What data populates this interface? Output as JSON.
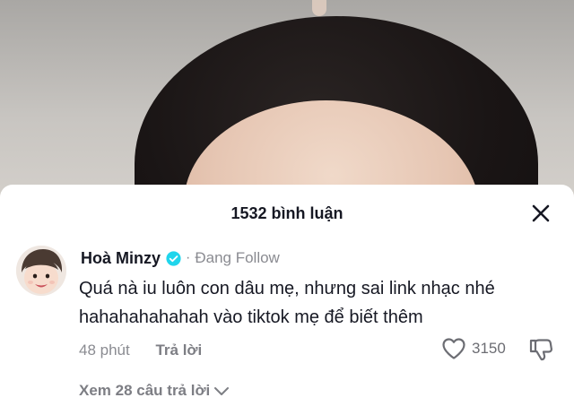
{
  "video": {
    "description_icon": "video-background"
  },
  "sheet": {
    "comment_count_label": "1532 bình luận",
    "close_icon": "close-icon"
  },
  "comment": {
    "username": "Hoà Minzy",
    "verified_icon": "verified-badge-icon",
    "separator": "·",
    "follow_status": "Đang Follow",
    "text": "Quá nà iu luôn con dâu mẹ, nhưng sai link nhạc nhé hahahahahahah vào tiktok mẹ để biết thêm",
    "time": "48 phút",
    "reply_label": "Trả lời",
    "like_count": "3150",
    "view_replies_label": "Xem 28 câu trả lời"
  },
  "colors": {
    "verified": "#20d5ec",
    "primary_text": "#161823",
    "secondary_text": "#8a8b91"
  }
}
